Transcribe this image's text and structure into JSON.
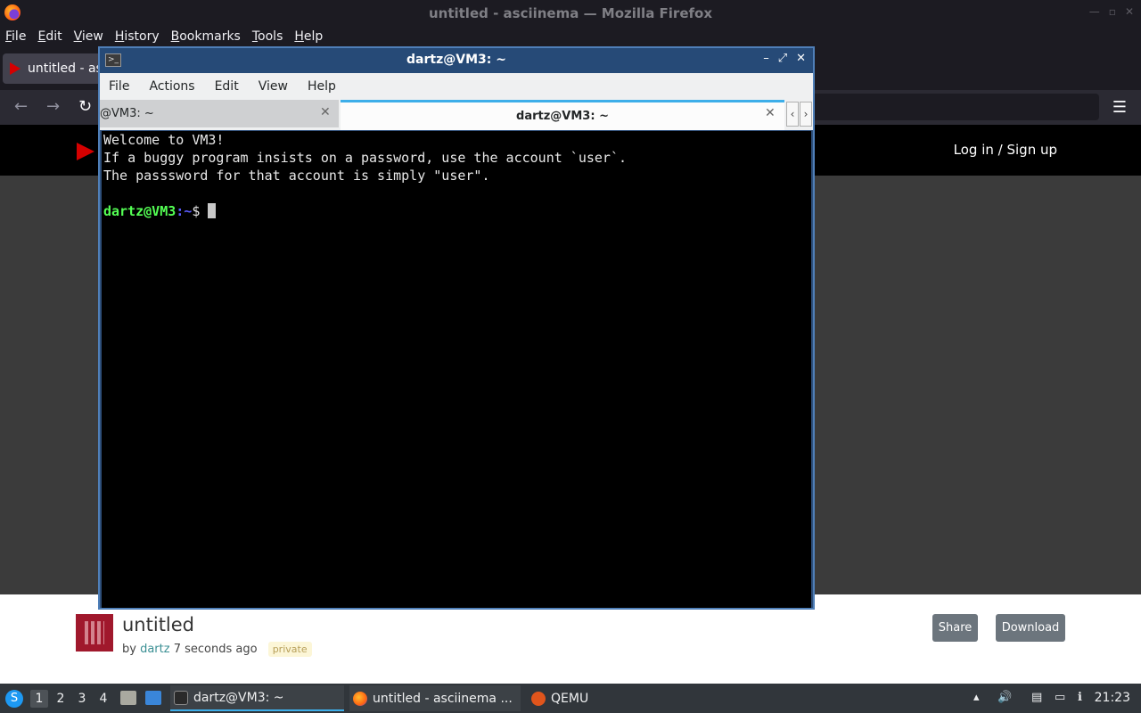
{
  "firefox": {
    "window_title": "untitled - asciinema — Mozilla Firefox",
    "menu": [
      "File",
      "Edit",
      "View",
      "History",
      "Bookmarks",
      "Tools",
      "Help"
    ],
    "tab_label": "untitled - as"
  },
  "site": {
    "login_label": "Log in / Sign up",
    "recording": {
      "title": "untitled",
      "by": "by",
      "author": "dartz",
      "time": "7 seconds ago",
      "badge": "private"
    },
    "share_label": "Share",
    "download_label": "Download"
  },
  "terminal": {
    "window_title": "dartz@VM3: ~",
    "menu": [
      "File",
      "Actions",
      "Edit",
      "View",
      "Help"
    ],
    "tab1_label": "@VM3: ~",
    "tab2_label": "dartz@VM3: ~",
    "lines": [
      "Welcome to VM3!",
      "If a buggy program insists on a password, use the account `user`.",
      "The passsword for that account is simply \"user\"."
    ],
    "prompt_user": "dartz@VM3",
    "prompt_path": ":~",
    "prompt_symbol": "$ "
  },
  "taskbar": {
    "desktops": [
      "1",
      "2",
      "3",
      "4"
    ],
    "tasks": [
      "dartz@VM3: ~",
      "untitled - asciinema ...",
      "QEMU"
    ],
    "clock": "21:23"
  },
  "colors": {
    "brand_red": "#d40000",
    "terminal_bg": "#000000",
    "prompt_green": "#54ff54",
    "prompt_blue": "#5c5cff",
    "kde_accent": "#3daee9"
  }
}
